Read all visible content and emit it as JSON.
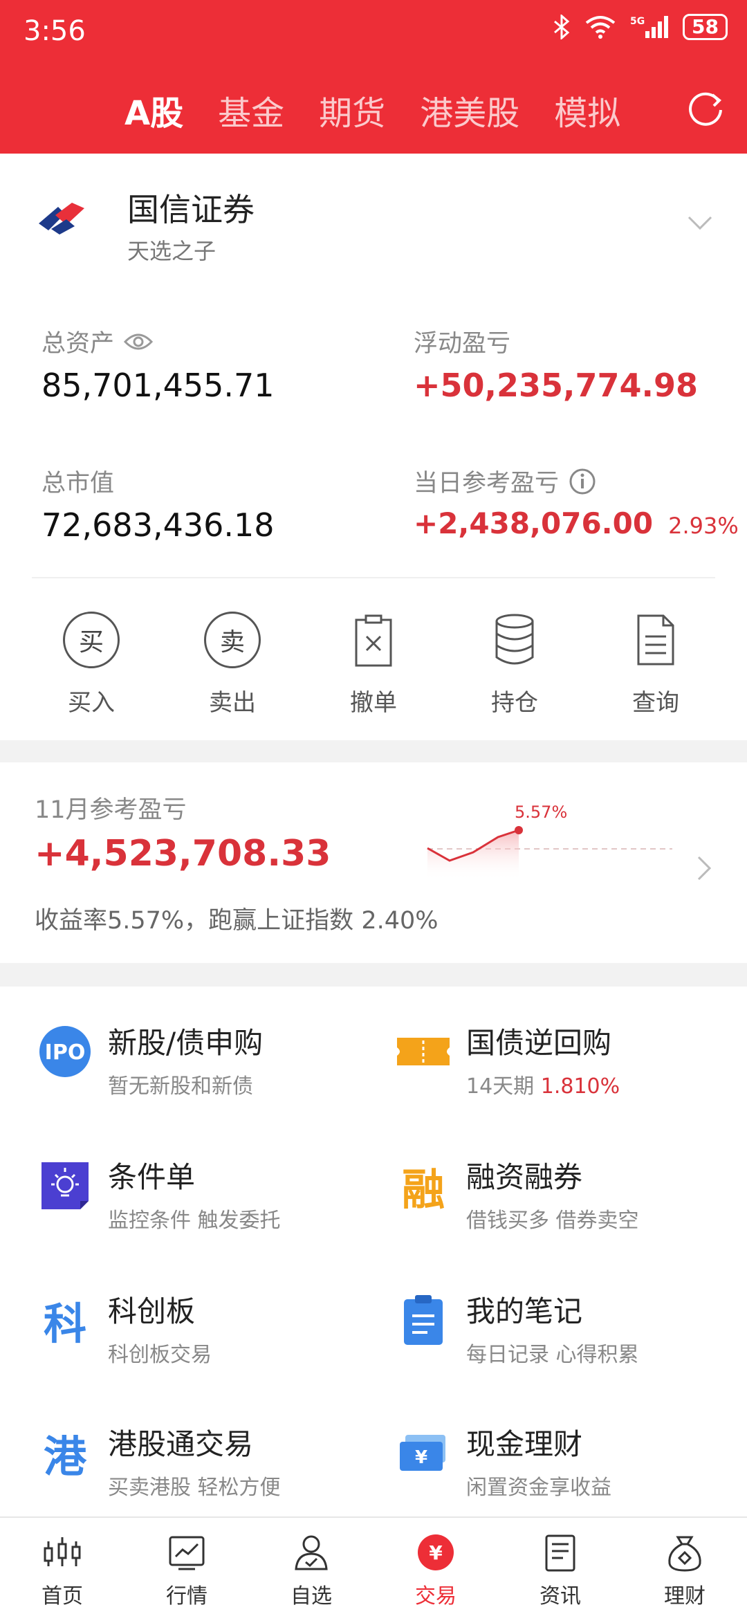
{
  "status": {
    "time": "3:56",
    "battery": "58"
  },
  "tabs": [
    {
      "label": "A股",
      "active": true
    },
    {
      "label": "基金"
    },
    {
      "label": "期货"
    },
    {
      "label": "港美股"
    },
    {
      "label": "模拟"
    }
  ],
  "account": {
    "broker": "国信证券",
    "nickname": "天选之子",
    "total_assets_label": "总资产",
    "total_assets": "85,701,455.71",
    "floating_pl_label": "浮动盈亏",
    "floating_pl": "+50,235,774.98",
    "market_value_label": "总市值",
    "market_value": "72,683,436.18",
    "daily_pl_label": "当日参考盈亏",
    "daily_pl": "+2,438,076.00",
    "daily_pl_pct": "2.93%"
  },
  "actions": [
    {
      "label": "买入",
      "glyph": "买",
      "icon": "buy-icon"
    },
    {
      "label": "卖出",
      "glyph": "卖",
      "icon": "sell-icon"
    },
    {
      "label": "撤单",
      "icon": "cancel-order-icon"
    },
    {
      "label": "持仓",
      "icon": "holdings-icon"
    },
    {
      "label": "查询",
      "icon": "query-icon"
    }
  ],
  "monthly": {
    "label": "11月参考盈亏",
    "value": "+4,523,708.33",
    "summary": "收益率5.57%，跑赢上证指数 2.40%",
    "spark_label": "5.57%"
  },
  "features": [
    {
      "title": "新股/债申购",
      "sub": "暂无新股和新债",
      "icon": "ipo-icon"
    },
    {
      "title": "国债逆回购",
      "sub": "14天期",
      "sub_highlight": "1.810%",
      "icon": "ticket-icon"
    },
    {
      "title": "条件单",
      "sub": "监控条件 触发委托",
      "icon": "lightbulb-icon"
    },
    {
      "title": "融资融券",
      "sub": "借钱买多 借券卖空",
      "glyph": "融",
      "icon": "margin-icon"
    },
    {
      "title": "科创板",
      "sub": "科创板交易",
      "glyph": "科",
      "icon": "star-market-icon"
    },
    {
      "title": "我的笔记",
      "sub": "每日记录 心得积累",
      "icon": "notes-icon"
    },
    {
      "title": "港股通交易",
      "sub": "买卖港股 轻松方便",
      "glyph": "港",
      "icon": "hk-connect-icon"
    },
    {
      "title": "现金理财",
      "sub": "闲置资金享收益",
      "icon": "cash-icon"
    }
  ],
  "nav": [
    {
      "label": "首页",
      "icon": "home-candles-icon"
    },
    {
      "label": "行情",
      "icon": "market-chart-icon"
    },
    {
      "label": "自选",
      "icon": "watchlist-person-icon"
    },
    {
      "label": "交易",
      "icon": "trade-yen-icon",
      "active": true
    },
    {
      "label": "资讯",
      "icon": "news-icon"
    },
    {
      "label": "理财",
      "icon": "wealth-bag-icon"
    }
  ],
  "colors": {
    "brand": "#ed2e37",
    "gain": "#d9323a",
    "ipo": "#3a86e8",
    "orange": "#f4a31a",
    "purple": "#4b3fd1"
  }
}
